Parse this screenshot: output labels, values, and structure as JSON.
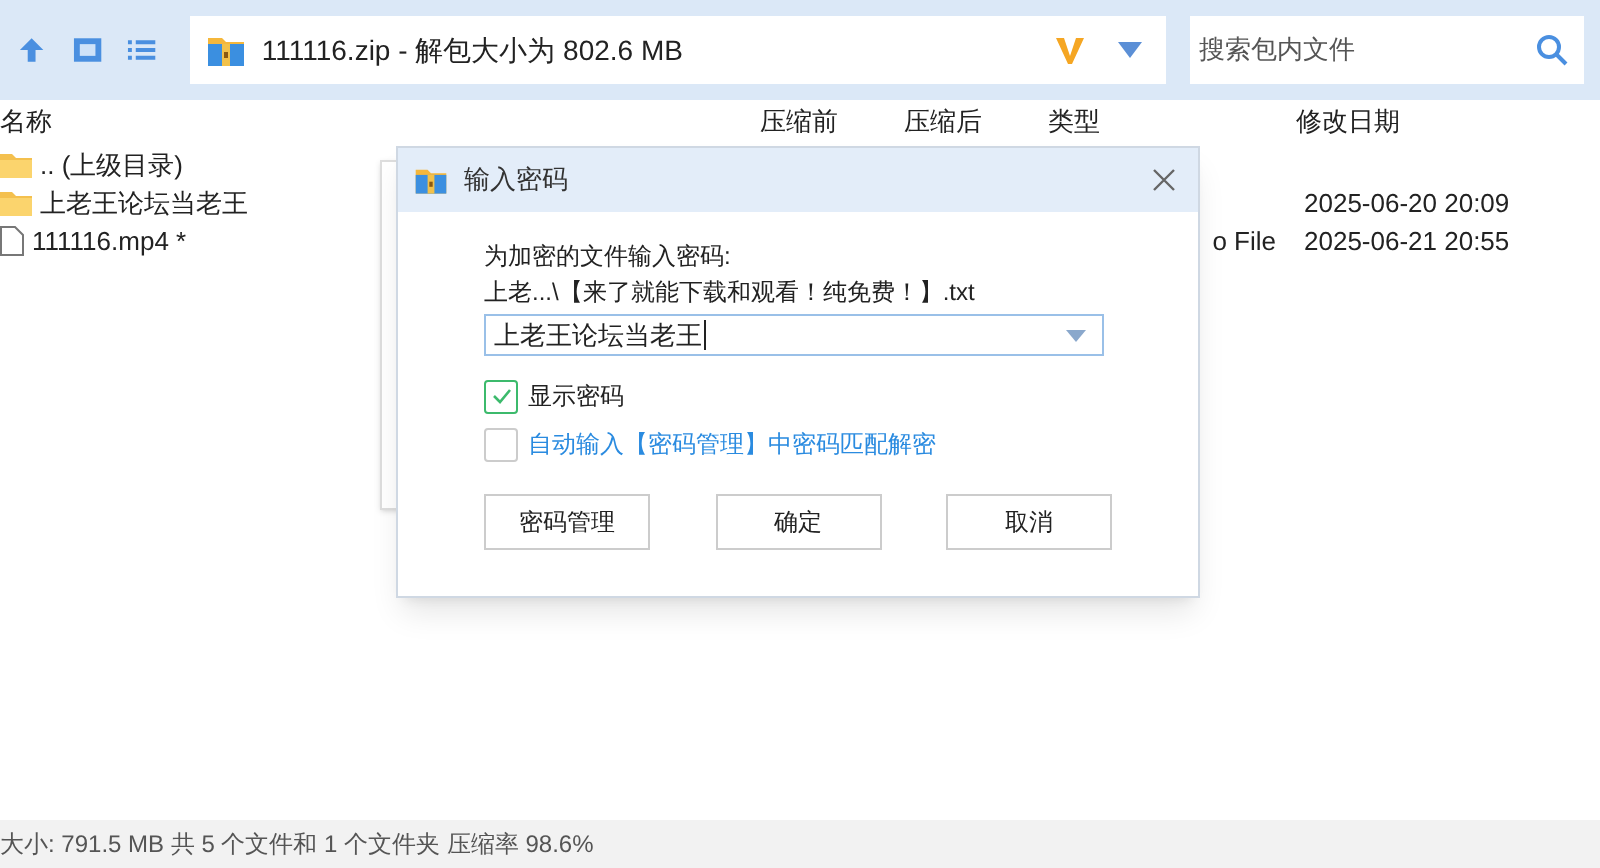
{
  "toolbar": {
    "address": "111116.zip - 解包大小为 802.6 MB",
    "search": {
      "placeholder": "搜索包内文件"
    }
  },
  "table": {
    "columns": [
      "名称",
      "压缩前",
      "压缩后",
      "类型",
      "修改日期"
    ],
    "rows": [
      {
        "kind": "folder",
        "name": ".. (上级目录)",
        "type": "",
        "date": ""
      },
      {
        "kind": "folder",
        "name": "上老王论坛当老王",
        "type": "",
        "date": "2025-06-20 20:09"
      },
      {
        "kind": "file",
        "name": "111116.mp4 *",
        "type": "o File",
        "date": "2025-06-21 20:55"
      }
    ]
  },
  "dialog": {
    "title": "输入密码",
    "prompt": "为加密的文件输入密码:",
    "file": "上老...\\【来了就能下载和观看！纯免费！】.txt",
    "password": "上老王论坛当老王",
    "options": [
      {
        "label": "显示密码",
        "checked": true,
        "link": false
      },
      {
        "label": "自动输入【密码管理】中密码匹配解密",
        "checked": false,
        "link": true
      }
    ],
    "buttons": [
      "密码管理",
      "确定",
      "取消"
    ]
  },
  "status_bar": "大小: 791.5 MB 共 5 个文件和 1 个文件夹 压缩率 98.6%"
}
